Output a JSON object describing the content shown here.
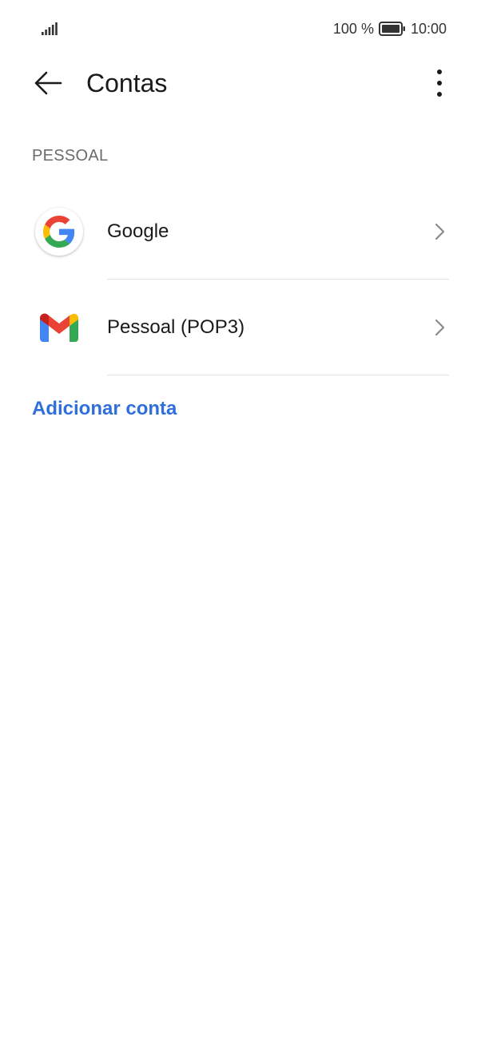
{
  "status_bar": {
    "battery_percent": "100 %",
    "time": "10:00",
    "signal_icon": "signal-bars-icon",
    "battery_icon": "battery-full-icon"
  },
  "app_bar": {
    "title": "Contas",
    "back_icon": "arrow-left-icon",
    "more_icon": "more-vertical-icon"
  },
  "section": {
    "header": "PESSOAL",
    "accounts": [
      {
        "label": "Google",
        "icon": "google-icon"
      },
      {
        "label": "Pessoal (POP3)",
        "icon": "gmail-icon"
      }
    ]
  },
  "actions": {
    "add_account": "Adicionar conta"
  },
  "colors": {
    "accent": "#2f6fdc",
    "text_primary": "#1a1a1a",
    "text_secondary": "#6b6b6b",
    "divider": "#e2e2e2"
  }
}
